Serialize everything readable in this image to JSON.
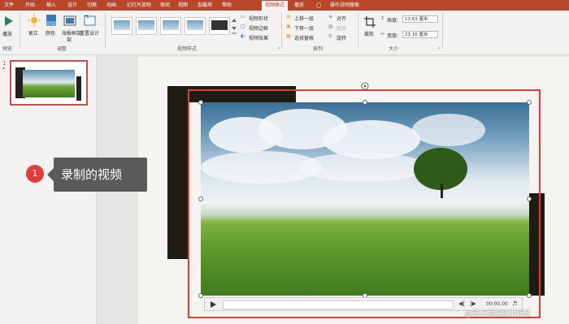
{
  "tabs": [
    "文件",
    "开始",
    "插入",
    "设计",
    "切换",
    "动画",
    "幻灯片放映",
    "审阅",
    "视图",
    "加载项",
    "帮助",
    "视频格式",
    "播放",
    "操作说明搜索"
  ],
  "active_tab_index": 11,
  "ribbon": {
    "play": "播放",
    "preview_group": "预览",
    "correct": "更正",
    "color": "颜色",
    "poster": "海报框架",
    "poster_suffix": "架",
    "reset": "重置设计",
    "adjust_group": "调整",
    "styles_group": "视频样式",
    "shape": "视频形状",
    "border": "视频边框",
    "effects": "视频效果",
    "bring_forward": "上移一层",
    "send_backward": "下移一层",
    "selection_pane": "选择窗格",
    "align": "对齐",
    "group": "组合",
    "rotate": "旋转",
    "arrange_group": "排列",
    "crop": "裁剪",
    "height_label": "高度:",
    "height_value": "13.63 厘米",
    "width_label": "宽度:",
    "width_value": "23.16 厘米",
    "size_group": "大小"
  },
  "slide_number": "1",
  "callout": {
    "badge": "1",
    "text": "录制的视频"
  },
  "video": {
    "time": "00:00.00"
  },
  "watermark": "@稀土掘金技术社区",
  "colors": {
    "accent": "#b7472a",
    "selection": "#e03c3c"
  }
}
